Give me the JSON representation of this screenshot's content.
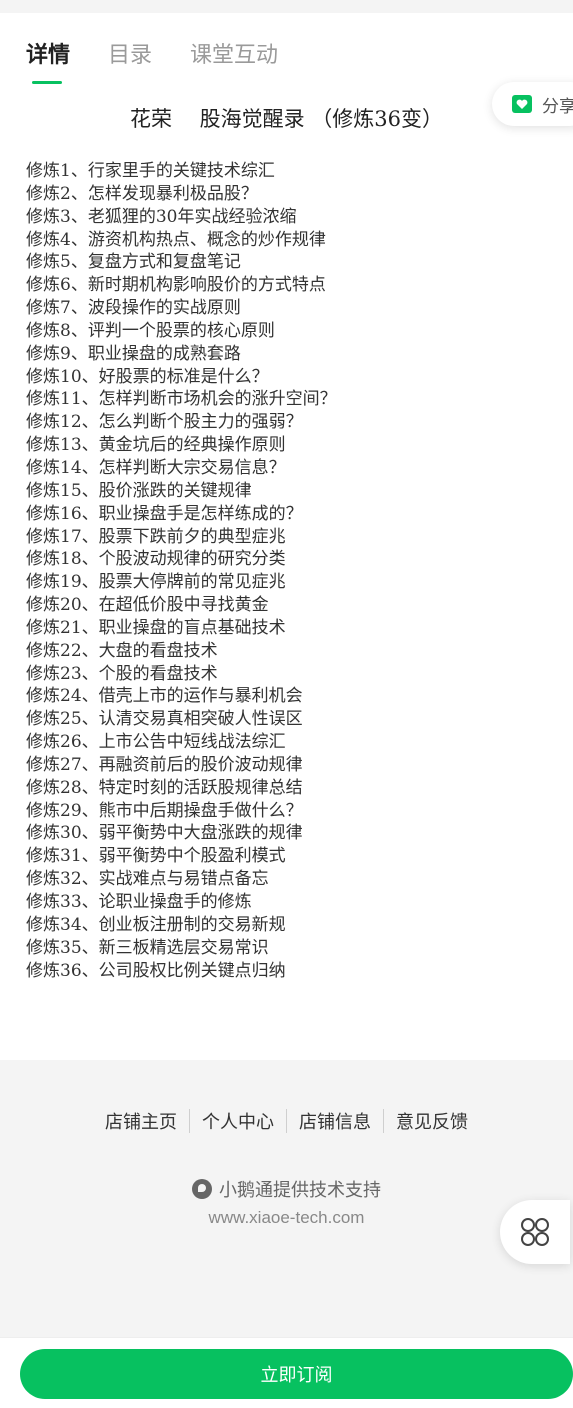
{
  "tabs": [
    {
      "label": "详情"
    },
    {
      "label": "目录"
    },
    {
      "label": "课堂互动"
    }
  ],
  "share": {
    "label": "分享",
    "icon": "share-icon"
  },
  "content": {
    "title": "花荣　 股海觉醒录 （修炼36变）",
    "chapters": [
      "修炼1、行家里手的关键技术综汇",
      "修炼2、怎样发现暴利极品股？",
      "修炼3、老狐狸的30年实战经验浓缩",
      "修炼4、游资机构热点、概念的炒作规律",
      "修炼5、复盘方式和复盘笔记",
      "修炼6、新时期机构影响股价的方式特点",
      "修炼7、波段操作的实战原则",
      "修炼8、评判一个股票的核心原则",
      "修炼9、职业操盘的成熟套路",
      "修炼10、好股票的标准是什么？",
      "修炼11、怎样判断市场机会的涨升空间？",
      "修炼12、怎么判断个股主力的强弱？",
      "修炼13、黄金坑后的经典操作原则",
      "修炼14、怎样判断大宗交易信息？",
      "修炼15、股价涨跌的关键规律",
      "修炼16、职业操盘手是怎样练成的？",
      "修炼17、股票下跌前夕的典型症兆",
      "修炼18、个股波动规律的研究分类",
      "修炼19、股票大停牌前的常见症兆",
      "修炼20、在超低价股中寻找黄金",
      "修炼21、职业操盘的盲点基础技术",
      "修炼22、大盘的看盘技术",
      "修炼23、个股的看盘技术",
      "修炼24、借壳上市的运作与暴利机会",
      "修炼25、认清交易真相突破人性误区",
      "修炼26、上市公告中短线战法综汇",
      "修炼27、再融资前后的股价波动规律",
      "修炼28、特定时刻的活跃股规律总结",
      "修炼29、熊市中后期操盘手做什么？",
      "修炼30、弱平衡势中大盘涨跌的规律",
      "修炼31、弱平衡势中个股盈利模式",
      "修炼32、实战难点与易错点备忘",
      "修炼33、论职业操盘手的修炼",
      "修炼34、创业板注册制的交易新规",
      "修炼35、新三板精选层交易常识",
      "修炼36、公司股权比例关键点归纳"
    ]
  },
  "footer": {
    "links": [
      {
        "label": "店铺主页"
      },
      {
        "label": "个人中心"
      },
      {
        "label": "店铺信息"
      },
      {
        "label": "意见反馈"
      }
    ],
    "powered_by": "小鹅通提供技术支持",
    "url": "www.xiaoe-tech.com"
  },
  "float_menu": {
    "icon": "grid-menu-icon"
  },
  "bottom": {
    "subscribe_label": "立即订阅"
  },
  "colors": {
    "accent": "#07c160",
    "text": "#333333",
    "muted": "#9a9a9a",
    "footer_bg": "#f4f4f4"
  }
}
